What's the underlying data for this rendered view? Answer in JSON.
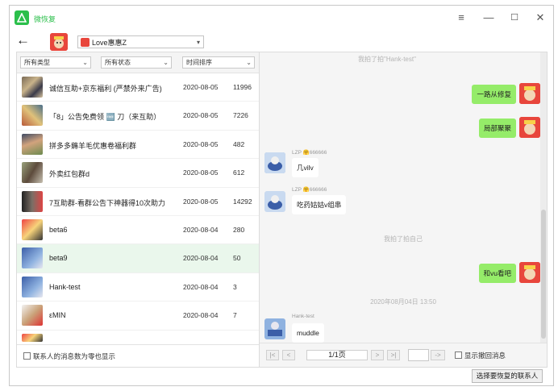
{
  "app": {
    "title": "微恢复",
    "logo_icon": "app-logo-icon",
    "brand_color": "#2bbf4b"
  },
  "toolbar": {
    "back_label": "←",
    "account_name": "Love惠惠Z"
  },
  "filters": {
    "type": "所有类型",
    "status": "所有状态",
    "sort": "时间排序"
  },
  "contacts": [
    {
      "name": "诚信互助+京东福利 (严禁外来广告)",
      "date": "2020-08-05",
      "count": "11996"
    },
    {
      "name": "「8」公告免费领 🆓 刀（来互助）",
      "date": "2020-08-05",
      "count": "7226"
    },
    {
      "name": "拼多多薅羊毛优惠卷福利群",
      "date": "2020-08-05",
      "count": "482"
    },
    {
      "name": "外卖红包群d",
      "date": "2020-08-05",
      "count": "612"
    },
    {
      "name": "7互助群-看群公告下神器得10次助力",
      "date": "2020-08-05",
      "count": "14292"
    },
    {
      "name": "beta6",
      "date": "2020-08-04",
      "count": "280"
    },
    {
      "name": "beta9",
      "date": "2020-08-04",
      "count": "50"
    },
    {
      "name": "Hank-test",
      "date": "2020-08-04",
      "count": "3"
    },
    {
      "name": "εMIN",
      "date": "2020-08-04",
      "count": "7"
    }
  ],
  "left_footer": {
    "show_zero_label": "联系人的消息数为零也显示"
  },
  "chat": {
    "top_sys": "我拍了拍\"Hank-test\"",
    "out1": "一路从修复",
    "out2": "局部聚聚",
    "sender_lzp1": "LZP 🤗666666",
    "in1": "几vilv",
    "sender_lzp2": "LZP 🤗666666",
    "in2": "吃药姑姑v组串",
    "sys_pat": "我拍了拍自己",
    "out3": "和vu看吧",
    "timestamp": "2020年08月04日 13:50",
    "sender_hank": "Hank-test",
    "in3": "muddle"
  },
  "pager": {
    "page_text": "1/1页",
    "go_label": "->",
    "show_recalled_label": "显示撤回消息"
  },
  "actions": {
    "restore_label": "选择要恢复的联系人"
  }
}
